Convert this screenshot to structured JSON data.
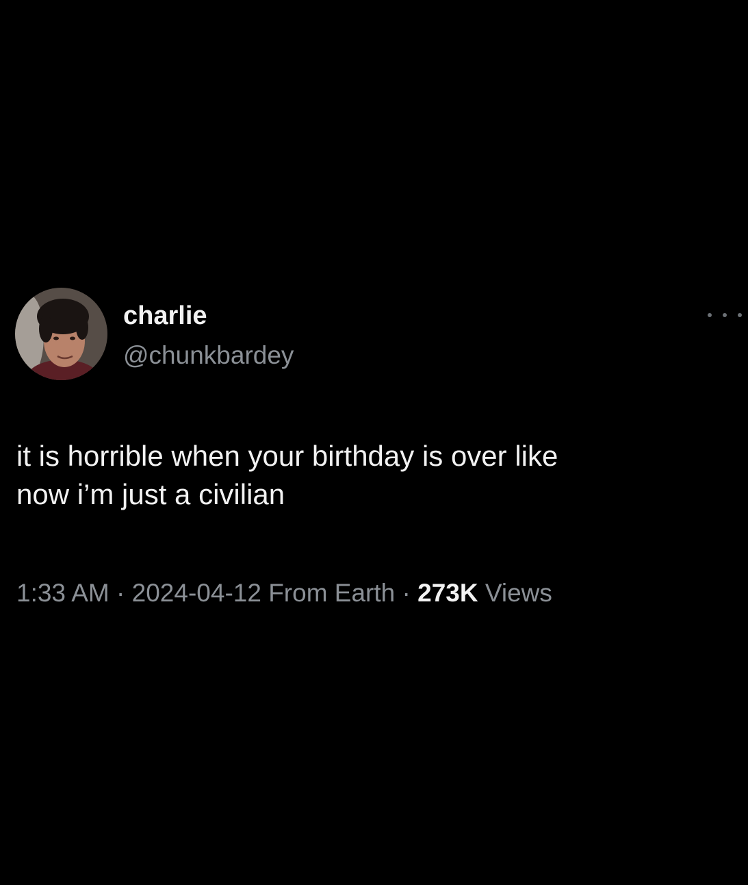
{
  "tweet": {
    "author": {
      "display_name": "charlie",
      "handle": "@chunkbardey",
      "avatar_icon": "user-photo-avatar"
    },
    "more_icon": "more-horizontal-icon",
    "text_lines": [
      "it is horrible when your birthday is over like",
      "now i’m just a civilian"
    ],
    "meta": {
      "time": "1:33 AM",
      "separator": "·",
      "date": "2024-04-12",
      "source": "From Earth",
      "views_count": "273K",
      "views_label": "Views"
    }
  },
  "colors": {
    "background": "#000000",
    "primary_text": "#f2f2f2",
    "secondary_text": "#8b9096"
  }
}
